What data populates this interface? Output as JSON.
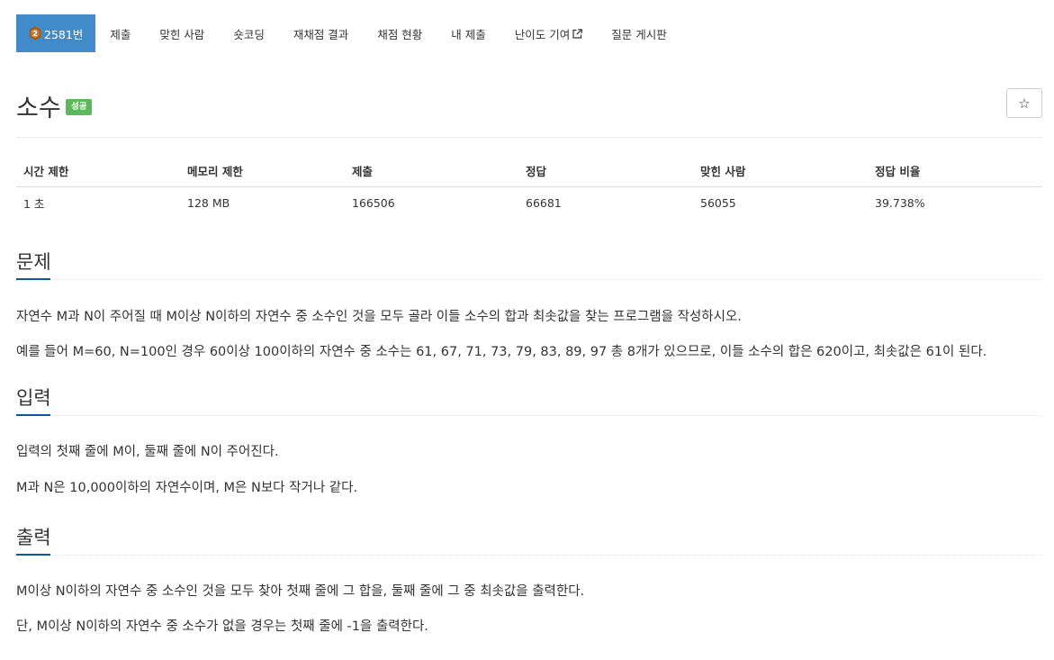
{
  "tabs": {
    "problem": "2581번",
    "submit": "제출",
    "solvers": "맞힌 사람",
    "short_coding": "숏코딩",
    "rejudge": "재채점 결과",
    "status": "채점 현황",
    "my_submit": "내 제출",
    "difficulty": "난이도 기여",
    "board": "질문 게시판"
  },
  "problem": {
    "title": "소수",
    "result": "성공",
    "star": "☆"
  },
  "info_table": {
    "headers": [
      "시간 제한",
      "메모리 제한",
      "제출",
      "정답",
      "맞힌 사람",
      "정답 비율"
    ],
    "values": [
      "1 초",
      "128 MB",
      "166506",
      "66681",
      "56055",
      "39.738%"
    ]
  },
  "sections": {
    "description": {
      "title": "문제",
      "paragraphs": [
        "자연수 M과 N이 주어질 때 M이상 N이하의 자연수 중 소수인 것을 모두 골라 이들 소수의 합과 최솟값을 찾는 프로그램을 작성하시오.",
        "예를 들어 M=60, N=100인 경우 60이상 100이하의 자연수 중 소수는 61, 67, 71, 73, 79, 83, 89, 97 총 8개가 있으므로, 이들 소수의 합은 620이고, 최솟값은 61이 된다."
      ]
    },
    "input": {
      "title": "입력",
      "paragraphs": [
        "입력의 첫째 줄에 M이, 둘째 줄에 N이 주어진다.",
        "M과 N은 10,000이하의 자연수이며, M은 N보다 작거나 같다."
      ]
    },
    "output": {
      "title": "출력",
      "paragraphs": [
        "M이상 N이하의 자연수 중 소수인 것을 모두 찾아 첫째 줄에 그 합을, 둘째 줄에 그 중 최솟값을 출력한다.",
        "단, M이상 N이하의 자연수 중 소수가 없을 경우는 첫째 줄에 -1을 출력한다."
      ]
    }
  },
  "colors": {
    "active_tab": "#428bca",
    "success_label": "#5cb85c",
    "section_accent": "#0c59a3",
    "tier_badge": "#ad5600"
  },
  "icons": {
    "tier": "bronze-tier-icon",
    "external": "external-link-icon",
    "star": "star-icon"
  }
}
